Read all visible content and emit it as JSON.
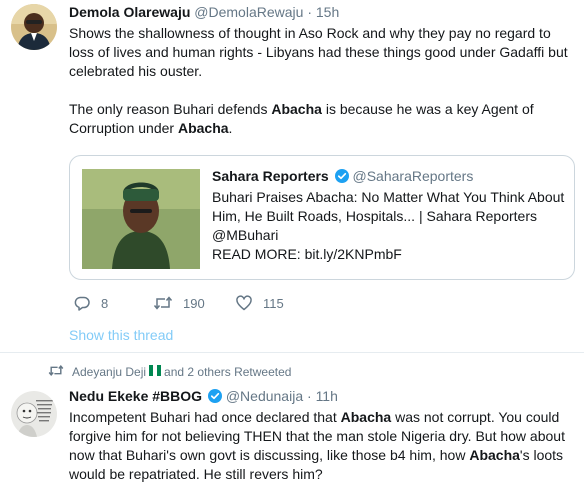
{
  "tweet1": {
    "author_name": "Demola Olarewaju",
    "author_handle": "@DemolaRewaju",
    "separator": "·",
    "time": "15h",
    "text_lines": [
      "Shows the shallowness of thought in Aso Rock and why they pay no regard to",
      "loss of lives and human rights - Libyans had these things good under Gadaffi but",
      "celebrated his ouster."
    ],
    "para2_line1_a": "The only reason Buhari defends ",
    "para2_line1_b": "Abacha",
    "para2_line1_c": " is because he was a key Agent of",
    "para2_line2_a": "Corruption under ",
    "para2_line2_b": "Abacha",
    "para2_line2_c": ".",
    "quote": {
      "author_name": "Sahara Reporters",
      "author_handle": "@SaharaReporters",
      "lines": [
        "Buhari Praises Abacha: No Matter What You Think About",
        "Him, He Built Roads, Hospitals... | Sahara Reporters",
        "@MBuhari",
        "READ MORE: bit.ly/2KNPmbF"
      ]
    },
    "actions": {
      "replies": "8",
      "retweets": "190",
      "likes": "115"
    },
    "show_thread": "Show this thread"
  },
  "tweet2": {
    "retweet_context_name": "Adeyanju Deji",
    "retweet_context_suffix": "and 2 others Retweeted",
    "author_name": "Nedu Ekeke #BBOG",
    "author_handle": "@Nedunaija",
    "separator": "·",
    "time": "11h",
    "line1_a": "Incompetent Buhari had once declared that ",
    "line1_b": "Abacha",
    "line1_c": " was not corrupt. You could",
    "line2": "forgive him for not believing THEN that the man stole Nigeria dry. But how about",
    "line3_a": "now that Buhari's own govt is discussing, like those b4 him, how ",
    "line3_b": "Abacha",
    "line3_c": "'s loots",
    "line4": "would be repatriated. He still revers him?"
  },
  "colors": {
    "link_blue": "#1da1f2",
    "secondary_gray": "#657786",
    "text_dark": "#14171a",
    "border": "#ccd6dd",
    "nigeria_green": "#008751"
  },
  "icons": {
    "reply": "reply-icon",
    "retweet": "retweet-icon",
    "like": "heart-icon",
    "verified": "verified-badge-icon",
    "flag": "nigeria-flag-icon"
  }
}
